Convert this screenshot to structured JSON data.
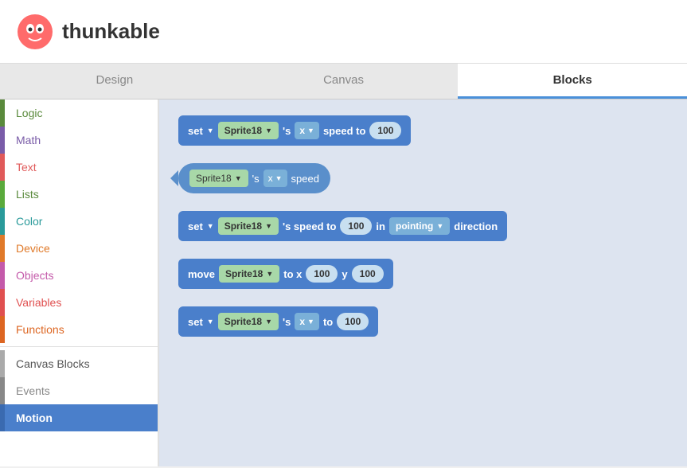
{
  "header": {
    "logo_alt": "thunkable logo",
    "brand_name": "thunkable"
  },
  "tabs": [
    {
      "id": "design",
      "label": "Design",
      "active": false
    },
    {
      "id": "canvas",
      "label": "Canvas",
      "active": false
    },
    {
      "id": "blocks",
      "label": "Blocks",
      "active": true
    }
  ],
  "sidebar": {
    "items": [
      {
        "id": "logic",
        "label": "Logic",
        "color": "#5a8a3c",
        "bar": "#5a8a3c"
      },
      {
        "id": "math",
        "label": "Math",
        "color": "#7a5ca8",
        "bar": "#7a5ca8"
      },
      {
        "id": "text",
        "label": "Text",
        "color": "#e05a5a",
        "bar": "#e05a5a"
      },
      {
        "id": "lists",
        "label": "Lists",
        "color": "#5a8a3c",
        "bar": "#5a8a3c"
      },
      {
        "id": "color",
        "label": "Color",
        "color": "#2a9a9a",
        "bar": "#2a9a9a"
      },
      {
        "id": "device",
        "label": "Device",
        "color": "#e07a2a",
        "bar": "#e07a2a"
      },
      {
        "id": "objects",
        "label": "Objects",
        "color": "#c45aaa",
        "bar": "#c45aaa"
      },
      {
        "id": "variables",
        "label": "Variables",
        "color": "#e05050",
        "bar": "#e05050"
      },
      {
        "id": "functions",
        "label": "Functions",
        "color": "#dd6622",
        "bar": "#dd6622"
      },
      {
        "id": "canvas-blocks",
        "label": "Canvas Blocks",
        "color": "#555",
        "bar": "#aaa"
      },
      {
        "id": "events",
        "label": "Events",
        "color": "#888",
        "bar": "#888"
      },
      {
        "id": "motion",
        "label": "Motion",
        "color": "white",
        "bar": "#4a7fcb",
        "active": true
      }
    ]
  },
  "blocks": {
    "set_speed": {
      "set_label": "set",
      "sprite_label": "Sprite18",
      "apostrophe_s": "'s",
      "x_label": "x",
      "speed_to_label": "speed to",
      "value": "100"
    },
    "get_speed": {
      "sprite_label": "Sprite18",
      "apostrophe_s": "'s",
      "x_label": "x",
      "speed_label": "speed"
    },
    "set_direction": {
      "set_label": "set",
      "sprite_label": "Sprite18",
      "speed_to_label": "'s speed to",
      "value": "100",
      "in_label": "in",
      "direction_label": "pointing",
      "direction_suffix": "direction"
    },
    "move": {
      "move_label": "move",
      "sprite_label": "Sprite18",
      "to_x_label": "to x",
      "x_value": "100",
      "y_label": "y",
      "y_value": "100"
    },
    "set_to": {
      "set_label": "set",
      "sprite_label": "Sprite18",
      "apostrophe_s": "'s",
      "x_label": "x",
      "to_label": "to",
      "value": "100"
    }
  }
}
